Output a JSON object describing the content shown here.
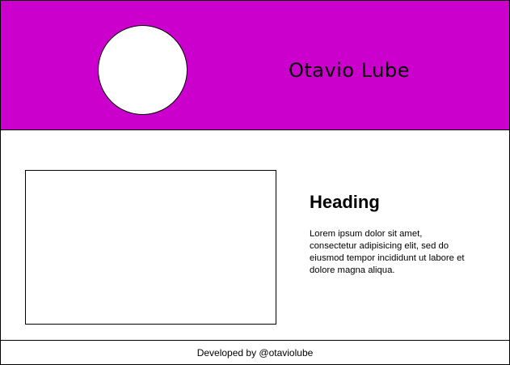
{
  "header": {
    "site_name": "Otavio Lube",
    "background_color": "#cc00cc",
    "avatar": "profile-photo-circle"
  },
  "nav": {
    "items": []
  },
  "main": {
    "image": "image-placeholder",
    "heading": "Heading",
    "body": "Lorem ipsum dolor sit amet, consectetur adipisicing elit, sed do eiusmod tempor incididunt ut labore et dolore magna aliqua."
  },
  "footer": {
    "credit": "Developed by @otaviolube"
  }
}
